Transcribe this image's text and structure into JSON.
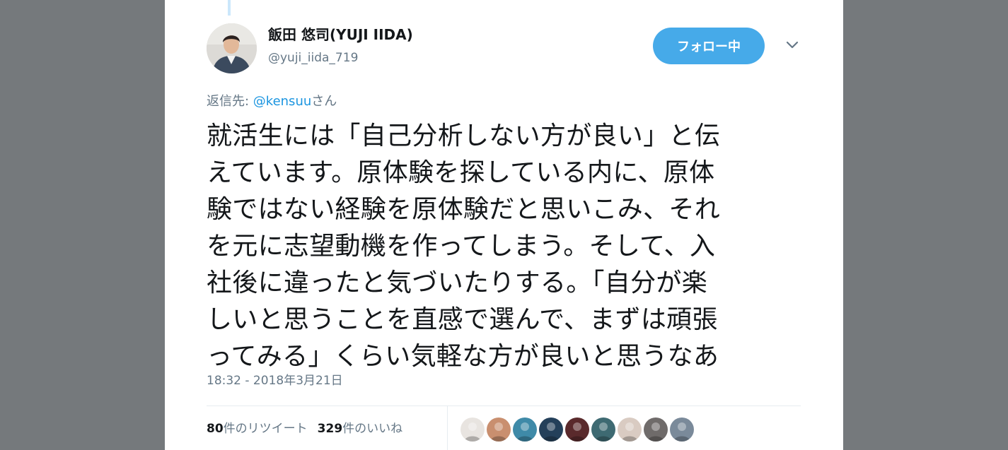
{
  "author": {
    "display_name": "飯田 悠司(YUJI IIDA)",
    "handle": "@yuji_iida_719"
  },
  "follow_button": {
    "label": "フォロー中"
  },
  "reply": {
    "prefix": "返信先: ",
    "mention": "@kensuu",
    "suffix": "さん"
  },
  "tweet": {
    "lines": [
      "就活生には「自己分析しない方が良い」と伝",
      "えています。原体験を探している内に、原体",
      "験ではない経験を原体験だと思いこみ、それ",
      "を元に志望動機を作ってしまう。そして、入",
      "社後に違ったと気づいたりする。「自分が楽",
      "しいと思うことを直感で選んで、まずは頑張",
      "ってみる」くらい気軽な方が良いと思うなあ"
    ],
    "timestamp": "18:32 - 2018年3月21日"
  },
  "stats": {
    "retweet_count": "80",
    "retweet_label": "件のリツイート",
    "like_count": "329",
    "like_label": "件のいいね"
  },
  "likers": [
    {
      "icon": "liker-avatar",
      "color": "#e8e4e0"
    },
    {
      "icon": "liker-avatar",
      "color": "#c98f6f"
    },
    {
      "icon": "liker-avatar",
      "color": "#3f8aa8"
    },
    {
      "icon": "liker-avatar",
      "color": "#24405a"
    },
    {
      "icon": "liker-avatar",
      "color": "#5a2a2c"
    },
    {
      "icon": "liker-avatar",
      "color": "#3e6a72"
    },
    {
      "icon": "liker-avatar",
      "color": "#d9cbc2"
    },
    {
      "icon": "liker-avatar",
      "color": "#6f6b6a"
    },
    {
      "icon": "liker-avatar",
      "color": "#7a8a9a"
    }
  ],
  "colors": {
    "background": "#75797c",
    "card": "#ffffff",
    "accent": "#46aae9",
    "link": "#1b95e0",
    "muted": "#657786",
    "text": "#14171a"
  }
}
